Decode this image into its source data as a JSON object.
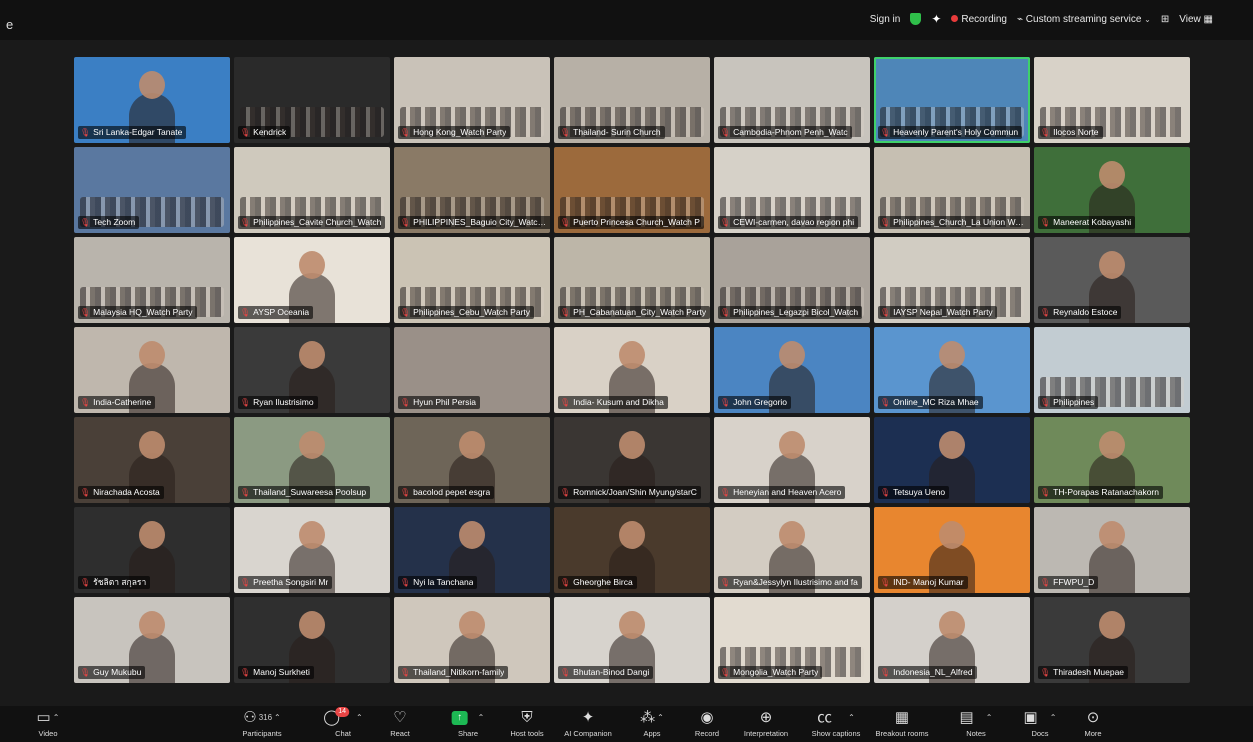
{
  "window": {
    "corner_char": "e"
  },
  "top_bar": {
    "sign_in": "Sign in",
    "recording": "Recording",
    "streaming": "Custom streaming service",
    "view": "View"
  },
  "tiles": [
    {
      "label": "Sri Lanka-Edgar Tanate",
      "bg": "#3b7fc4",
      "kind": "person"
    },
    {
      "label": "Kendrick",
      "bg": "#2a2a2a",
      "kind": "crowd"
    },
    {
      "label": "Hong Kong_Watch Party",
      "bg": "#c9c2b8",
      "kind": "crowd"
    },
    {
      "label": "Thailand- Surin Church",
      "bg": "#b7b0a6",
      "kind": "crowd"
    },
    {
      "label": "Cambodia-Phnom Penh_Watc",
      "bg": "#c8c4bd",
      "kind": "crowd"
    },
    {
      "label": "Heavenly Parent's Holy Commun",
      "bg": "#4e86b8",
      "kind": "crowd",
      "active": true
    },
    {
      "label": "Ilocos Norte",
      "bg": "#d8d2c8",
      "kind": "crowd"
    },
    {
      "label": "Tech Zoom",
      "bg": "#5a78a0",
      "kind": "crowd"
    },
    {
      "label": "Philippines_Cavite Church_Watch",
      "bg": "#cfc9bd",
      "kind": "crowd"
    },
    {
      "label": "PHILIPPINES_Baguio City_Watch P",
      "bg": "#8a7a66",
      "kind": "crowd"
    },
    {
      "label": "Puerto Princesa Church_Watch P",
      "bg": "#9c6a3c",
      "kind": "crowd"
    },
    {
      "label": "CEWI-carmen, davao region phi",
      "bg": "#d6d1c8",
      "kind": "crowd"
    },
    {
      "label": "Philippines_Church_La Union Watch",
      "bg": "#c6bfb2",
      "kind": "crowd"
    },
    {
      "label": "Maneerat Kobayashi",
      "bg": "#3f6f3a",
      "kind": "person"
    },
    {
      "label": "Malaysia HQ_Watch Party",
      "bg": "#b9b4ac",
      "kind": "crowd"
    },
    {
      "label": "AYSP Oceania",
      "bg": "#e8e2d8",
      "kind": "person"
    },
    {
      "label": "Philippines_Cebu_Watch Party",
      "bg": "#cbc3b4",
      "kind": "crowd"
    },
    {
      "label": "PH_Cabanatuan_City_Watch Party",
      "bg": "#bdb6a8",
      "kind": "crowd"
    },
    {
      "label": "Philippines_Legazpi Bicol_Watch",
      "bg": "#a9a29a",
      "kind": "crowd"
    },
    {
      "label": "IAYSP Nepal_Watch Party",
      "bg": "#d1ccc2",
      "kind": "crowd"
    },
    {
      "label": "Reynaldo Estoce",
      "bg": "#5a5a5a",
      "kind": "person"
    },
    {
      "label": "India-Catherine",
      "bg": "#bfb7ad",
      "kind": "person"
    },
    {
      "label": "Ryan Ilustrisimo",
      "bg": "#3a3a3a",
      "kind": "person"
    },
    {
      "label": "Hyun Phil Persia",
      "bg": "#9a9088",
      "kind": "none"
    },
    {
      "label": "India- Kusum and Dikha",
      "bg": "#d9d1c6",
      "kind": "person"
    },
    {
      "label": "John Gregorio",
      "bg": "#4b85c2",
      "kind": "person"
    },
    {
      "label": "Online_MC Riza Mhae",
      "bg": "#5a95cf",
      "kind": "person"
    },
    {
      "label": "Philippines",
      "bg": "#c2ccd2",
      "kind": "crowd"
    },
    {
      "label": "Nirachada Acosta",
      "bg": "#4a4038",
      "kind": "person"
    },
    {
      "label": "Thailand_Suwareesa Poolsup",
      "bg": "#8b9a82",
      "kind": "person"
    },
    {
      "label": "bacolod pepet esgra",
      "bg": "#6e6558",
      "kind": "person"
    },
    {
      "label": "Romnick/Joan/Shin Myung/starC",
      "bg": "#3a3633",
      "kind": "person"
    },
    {
      "label": "Heneyian and Heaven Acero",
      "bg": "#d8d2ca",
      "kind": "person"
    },
    {
      "label": "Tetsuya Ueno",
      "bg": "#1c2f52",
      "kind": "person"
    },
    {
      "label": "TH-Porapas Ratanachakorn",
      "bg": "#6f8a5a",
      "kind": "person"
    },
    {
      "label": "รัชลิตา สกุลรา",
      "bg": "#2e2e2e",
      "kind": "person"
    },
    {
      "label": "Preetha Songsiri Mr",
      "bg": "#d9d5cf",
      "kind": "person"
    },
    {
      "label": "Nyi la Tanchana",
      "bg": "#24314a",
      "kind": "person"
    },
    {
      "label": "Gheorghe Birca",
      "bg": "#4a3a2c",
      "kind": "person"
    },
    {
      "label": "Ryan&Jessylyn Ilustrisimo and fa",
      "bg": "#d3ccc2",
      "kind": "person"
    },
    {
      "label": "IND- Manoj Kumar",
      "bg": "#e8862f",
      "kind": "person"
    },
    {
      "label": "FFWPU_D",
      "bg": "#bcb8b2",
      "kind": "person"
    },
    {
      "label": "Guy Mukubu",
      "bg": "#c8c4be",
      "kind": "person"
    },
    {
      "label": "Manoj Surkheti",
      "bg": "#2f2f2f",
      "kind": "person"
    },
    {
      "label": "Thailand_Nitikorn-family",
      "bg": "#cfc7bc",
      "kind": "person"
    },
    {
      "label": "Bhutan-Binod Dangi",
      "bg": "#d7d3cd",
      "kind": "person"
    },
    {
      "label": "Mongolia_Watch Party",
      "bg": "#e2dbd0",
      "kind": "crowd"
    },
    {
      "label": "Indonesia_NL_Alfred",
      "bg": "#d4d0cb",
      "kind": "person"
    },
    {
      "label": "Thiradesh Muepae",
      "bg": "#3a3a3a",
      "kind": "person"
    }
  ],
  "toolbar": {
    "video": "Video",
    "participants": "Participants",
    "participants_count": "316",
    "chat": "Chat",
    "chat_badge": "14",
    "react": "React",
    "share": "Share",
    "host_tools": "Host tools",
    "ai_companion": "AI Companion",
    "apps": "Apps",
    "record": "Record",
    "interpretation": "Interpretation",
    "show_captions": "Show captions",
    "breakout_rooms": "Breakout rooms",
    "notes": "Notes",
    "docs": "Docs",
    "more": "More"
  }
}
